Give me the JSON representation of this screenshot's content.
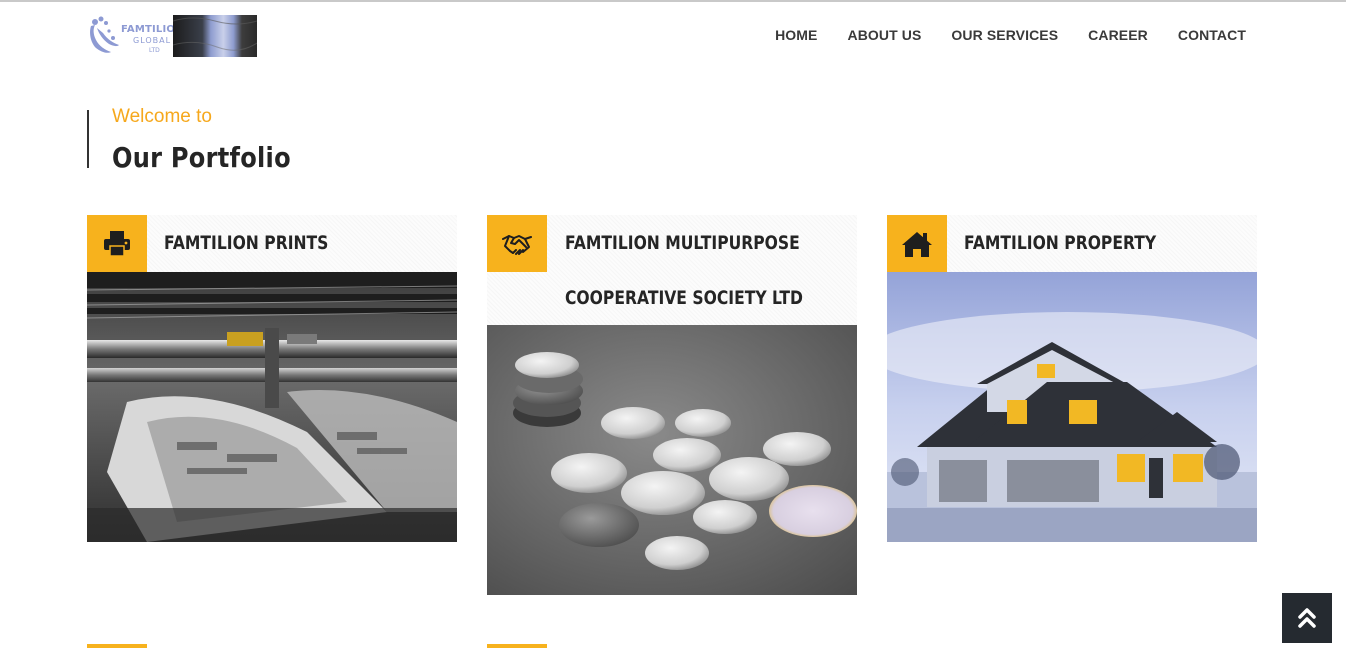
{
  "header": {
    "logo": {
      "line1": "FAMTILION",
      "line2": "GLOBAL",
      "line3": "LTD"
    },
    "nav": [
      {
        "label": "HOME"
      },
      {
        "label": "ABOUT US"
      },
      {
        "label": "OUR SERVICES"
      },
      {
        "label": "CAREER"
      },
      {
        "label": "CONTACT"
      }
    ]
  },
  "section": {
    "subtitle": "Welcome to",
    "title": "Our Portfolio"
  },
  "cards": [
    {
      "title": "FAMTILION PRINTS",
      "icon": "printer-icon",
      "image": "printing-press-photo"
    },
    {
      "title_line1": "FAMTILION MULTIPURPOSE",
      "title_line2": "COOPERATIVE SOCIETY LTD",
      "icon": "handshake-icon",
      "image": "coins-photo"
    },
    {
      "title": "FAMTILION PROPERTY",
      "icon": "home-icon",
      "image": "house-photo"
    }
  ],
  "colors": {
    "accent": "#f7b21d",
    "text_dark": "#252525",
    "subtitle": "#f6a81c",
    "scroll_button": "#252a30"
  },
  "scroll_top": {
    "icon": "double-chevron-up-icon"
  }
}
